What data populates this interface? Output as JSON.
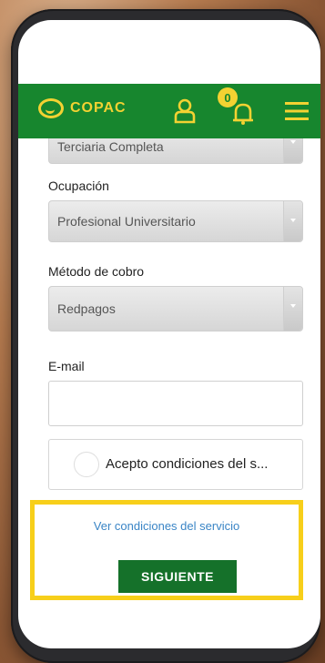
{
  "header": {
    "brand": "COPAC",
    "notification_count": "0"
  },
  "form": {
    "education_value": "Terciaria Completa",
    "occupation_label": "Ocupación",
    "occupation_value": "Profesional Universitario",
    "payment_label": "Método de cobro",
    "payment_value": "Redpagos",
    "email_label": "E-mail",
    "email_value": "",
    "terms_checkbox_label": "Acepto condiciones del s..."
  },
  "footer": {
    "terms_link": "Ver condiciones del servicio",
    "next_button": "SIGUIENTE"
  },
  "colors": {
    "header_green": "#17862e",
    "accent_yellow": "#f3d232",
    "button_green": "#15712a",
    "highlight_yellow": "#f7cf1a",
    "link_blue": "#3a85c6"
  },
  "icons": [
    "copac-logo-icon",
    "user-icon",
    "bell-icon",
    "menu-icon",
    "dropdown-arrow-icon"
  ]
}
